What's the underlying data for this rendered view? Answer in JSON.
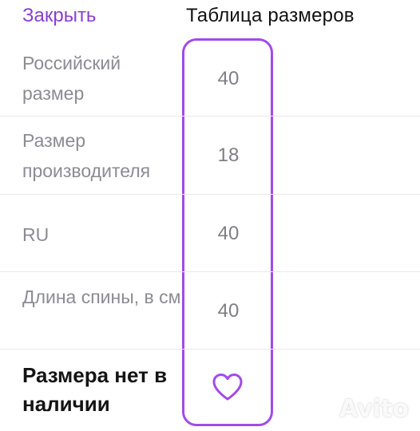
{
  "header": {
    "close_label": "Закрыть",
    "title": "Таблица размеров"
  },
  "rows": [
    {
      "label": "Российский размер",
      "value": "40"
    },
    {
      "label": "Размер производителя",
      "value": "18"
    },
    {
      "label": "RU",
      "value": "40"
    },
    {
      "label": "Длина спины, в см",
      "value": "40"
    }
  ],
  "availability": {
    "status_text": "Размера нет в наличии",
    "favorite_icon": "heart-outline-icon"
  },
  "colors": {
    "accent": "#8a3fd1",
    "highlight_border": "#a24be8",
    "label_gray": "#8b8b93"
  },
  "watermark": "Avito"
}
